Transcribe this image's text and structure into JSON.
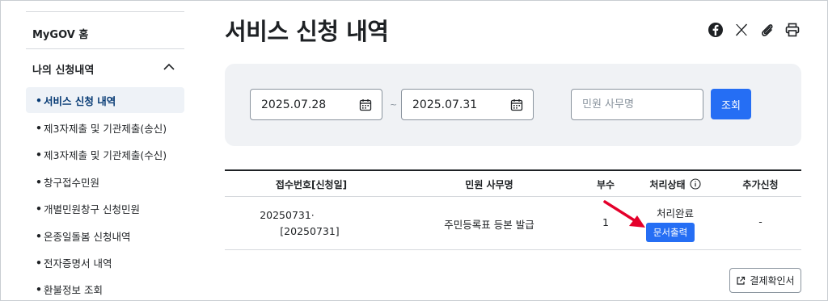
{
  "sidebar": {
    "home_label": "MyGOV 홈",
    "group_label": "나의 신청내역",
    "items": [
      {
        "label": "서비스 신청 내역",
        "active": true
      },
      {
        "label": "제3자제출 및 기관제출(송신)",
        "active": false
      },
      {
        "label": "제3자제출 및 기관제출(수신)",
        "active": false
      },
      {
        "label": "창구접수민원",
        "active": false
      },
      {
        "label": "개별민원창구 신청민원",
        "active": false
      },
      {
        "label": "온종일돌봄 신청내역",
        "active": false
      },
      {
        "label": "전자증명서 내역",
        "active": false
      },
      {
        "label": "환불정보 조회",
        "active": false
      }
    ]
  },
  "page": {
    "title": "서비스 신청 내역",
    "share_icons": [
      "facebook-icon",
      "x-icon",
      "link-icon",
      "print-icon"
    ]
  },
  "filter": {
    "start_date": "2025.07.28",
    "separator": "~",
    "end_date": "2025.07.31",
    "search_placeholder": "민원 사무명",
    "search_button": "조회"
  },
  "table": {
    "headers": [
      "접수번호[신청일]",
      "민원 사무명",
      "부수",
      "처리상태",
      "추가신청"
    ],
    "rows": [
      {
        "receipt_no": "20250731·",
        "apply_date": "[20250731]",
        "service": "주민등록표 등본 발급",
        "copies": "1",
        "status": "처리완료",
        "action": "문서출력",
        "extra": "-"
      }
    ]
  },
  "footer": {
    "receipt_button": "결제확인서"
  },
  "colors": {
    "primary": "#256ef4",
    "annotation_arrow": "#e4002b",
    "active_bg": "#eef2f7",
    "filter_bg": "#f0f2f5"
  }
}
